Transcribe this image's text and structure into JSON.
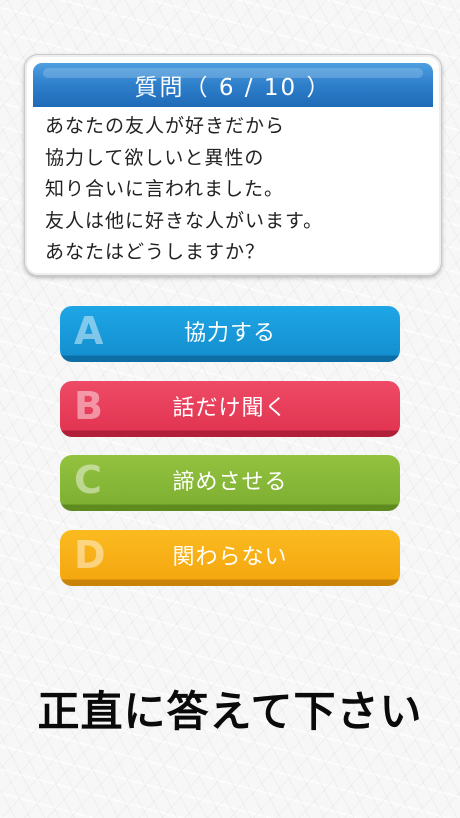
{
  "question": {
    "title": "質問（ 6 / 10 ）",
    "lines": [
      "あなたの友人が好きだから",
      "協力して欲しいと異性の",
      "知り合いに言われました。",
      "友人は他に好きな人がいます。",
      "あなたはどうしますか？"
    ]
  },
  "answers": [
    {
      "letter": "A",
      "label": "協力する",
      "color": "#1ea6e6"
    },
    {
      "letter": "B",
      "label": "話だけ聞く",
      "color": "#ee4b66"
    },
    {
      "letter": "C",
      "label": "諦めさせる",
      "color": "#93c23f"
    },
    {
      "letter": "D",
      "label": "関わらない",
      "color": "#fbbb20"
    }
  ],
  "instruction": "正直に答えて下さい"
}
